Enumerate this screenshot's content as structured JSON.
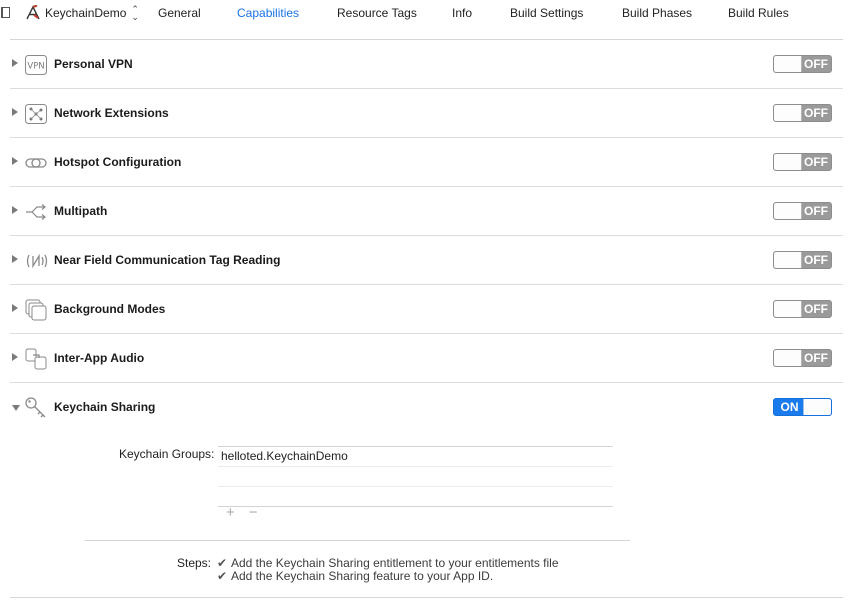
{
  "target": {
    "name": "KeychainDemo",
    "icon": "xcode-app-icon"
  },
  "tabs": [
    {
      "label": "General",
      "active": false
    },
    {
      "label": "Capabilities",
      "active": true
    },
    {
      "label": "Resource Tags",
      "active": false
    },
    {
      "label": "Info",
      "active": false
    },
    {
      "label": "Build Settings",
      "active": false
    },
    {
      "label": "Build Phases",
      "active": false
    },
    {
      "label": "Build Rules",
      "active": false
    }
  ],
  "capabilities": [
    {
      "label": "Personal VPN",
      "icon": "vpn-icon",
      "state": "OFF"
    },
    {
      "label": "Network Extensions",
      "icon": "network-extensions-icon",
      "state": "OFF"
    },
    {
      "label": "Hotspot Configuration",
      "icon": "hotspot-icon",
      "state": "OFF"
    },
    {
      "label": "Multipath",
      "icon": "multipath-icon",
      "state": "OFF"
    },
    {
      "label": "Near Field Communication Tag Reading",
      "icon": "nfc-icon",
      "state": "OFF"
    },
    {
      "label": "Background Modes",
      "icon": "background-modes-icon",
      "state": "OFF"
    },
    {
      "label": "Inter-App Audio",
      "icon": "inter-app-audio-icon",
      "state": "OFF"
    },
    {
      "label": "Keychain Sharing",
      "icon": "key-icon",
      "state": "ON"
    }
  ],
  "keychain": {
    "groups_label": "Keychain Groups:",
    "groups": [
      "helloted.KeychainDemo"
    ],
    "add_symbol": "+",
    "remove_symbol": "−",
    "steps_label": "Steps:",
    "steps": [
      "Add the Keychain Sharing entitlement to your entitlements file",
      "Add the Keychain Sharing feature to your App ID."
    ]
  },
  "colors": {
    "accent": "#1a7bec",
    "switch_off": "#9a9a9a",
    "active_tab": "#1a73e8"
  }
}
